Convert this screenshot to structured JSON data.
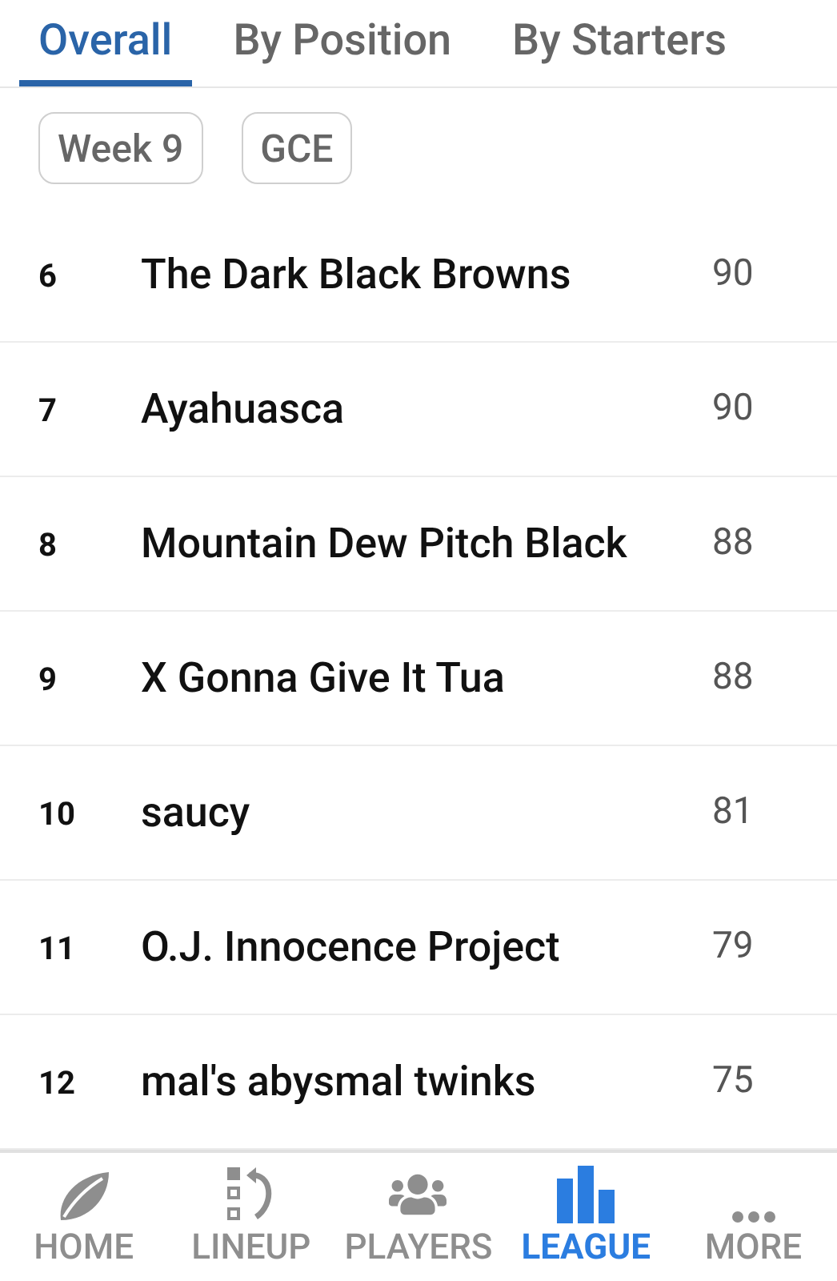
{
  "tabs": [
    {
      "label": "Overall",
      "selected": true
    },
    {
      "label": "By Position",
      "selected": false
    },
    {
      "label": "By Starters",
      "selected": false
    }
  ],
  "filters": [
    "Week 9",
    "GCE"
  ],
  "standings": [
    {
      "rank": "6",
      "team": "The Dark Black Browns",
      "points": "90"
    },
    {
      "rank": "7",
      "team": "Ayahuasca",
      "points": "90"
    },
    {
      "rank": "8",
      "team": "Mountain Dew Pitch Black",
      "points": "88"
    },
    {
      "rank": "9",
      "team": "X Gonna Give It Tua",
      "points": "88"
    },
    {
      "rank": "10",
      "team": "saucy",
      "points": "81"
    },
    {
      "rank": "11",
      "team": "O.J. Innocence Project",
      "points": "79"
    },
    {
      "rank": "12",
      "team": "mal's abysmal twinks",
      "points": "75"
    }
  ],
  "nav": [
    {
      "kind": "home",
      "label": "HOME",
      "selected": false
    },
    {
      "kind": "lineup",
      "label": "LINEUP",
      "selected": false
    },
    {
      "kind": "players",
      "label": "PLAYERS",
      "selected": false
    },
    {
      "kind": "league",
      "label": "LEAGUE",
      "selected": true
    },
    {
      "kind": "more",
      "label": "MORE",
      "selected": false
    }
  ]
}
